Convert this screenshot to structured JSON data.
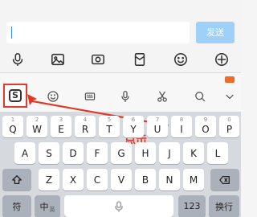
{
  "compose": {
    "send_label": "发送",
    "toolbar_icons": [
      "microphone-icon",
      "image-icon",
      "camera-icon",
      "red-packet-icon",
      "emoji-icon",
      "plus-icon"
    ]
  },
  "keyboard_bar": {
    "icons": [
      "sogou-logo",
      "emoji-icon",
      "keyboard-icon",
      "microphone-icon",
      "scissors-icon",
      "search-icon",
      "chevron-down-icon"
    ],
    "sogou_logo_text": "S",
    "annotation": "点击",
    "annotation_color": "#e53525"
  },
  "keys": {
    "row1": [
      {
        "ch": "Q",
        "num": "1"
      },
      {
        "ch": "W",
        "num": "2"
      },
      {
        "ch": "E",
        "num": "3"
      },
      {
        "ch": "R",
        "num": "4"
      },
      {
        "ch": "T",
        "num": "5"
      },
      {
        "ch": "Y",
        "num": "6"
      },
      {
        "ch": "U",
        "num": "7"
      },
      {
        "ch": "I",
        "num": "8"
      },
      {
        "ch": "O",
        "num": "9"
      },
      {
        "ch": "P",
        "num": "0"
      }
    ],
    "row2": [
      "A",
      "S",
      "D",
      "F",
      "G",
      "H",
      "J",
      "K",
      "L"
    ],
    "row3": [
      "Z",
      "X",
      "C",
      "V",
      "B",
      "N",
      "M"
    ],
    "symbol": "符",
    "chinese": "中",
    "chinese_sub": "英",
    "numbers": "123",
    "newline": "换行"
  }
}
